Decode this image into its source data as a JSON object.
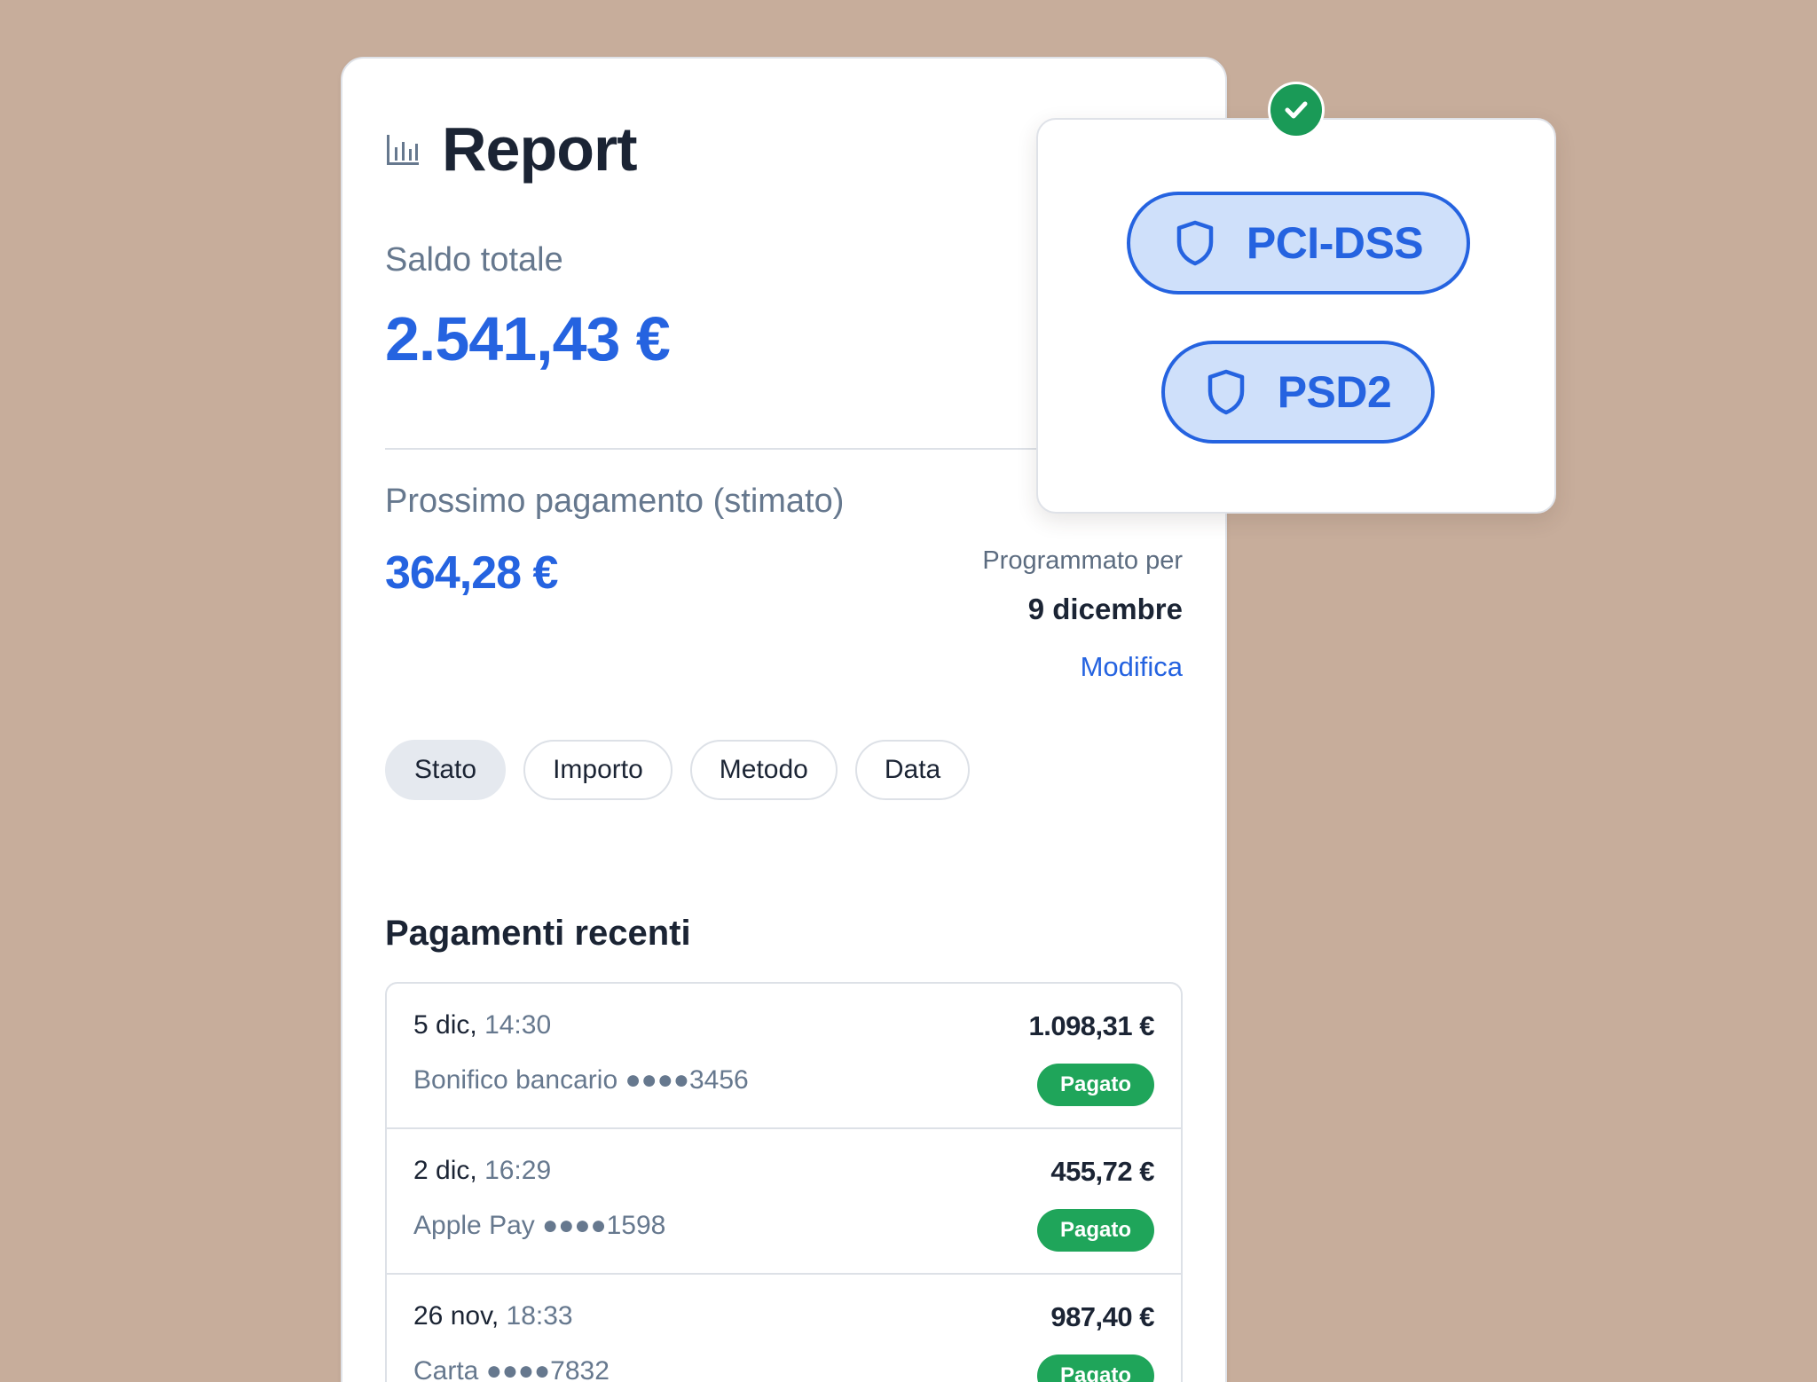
{
  "report": {
    "title": "Report",
    "balance": {
      "label": "Saldo totale",
      "value": "2.541,43 €"
    },
    "next_payment": {
      "label": "Prossimo pagamento (stimato)",
      "value": "364,28 €",
      "scheduled_label": "Programmato per",
      "scheduled_date": "9 dicembre",
      "edit_link": "Modifica"
    },
    "filters": [
      {
        "label": "Stato",
        "active": true
      },
      {
        "label": "Importo",
        "active": false
      },
      {
        "label": "Metodo",
        "active": false
      },
      {
        "label": "Data",
        "active": false
      }
    ],
    "recent": {
      "title": "Pagamenti recenti",
      "payments": [
        {
          "date": "5 dic,",
          "time": "14:30",
          "method": "Bonifico bancario ●●●●3456",
          "amount": "1.098,31 €",
          "status": "Pagato"
        },
        {
          "date": "2 dic,",
          "time": "16:29",
          "method": "Apple Pay ●●●●1598",
          "amount": "455,72 €",
          "status": "Pagato"
        },
        {
          "date": "26 nov,",
          "time": "18:33",
          "method": "Carta ●●●●7832",
          "amount": "987,40 €",
          "status": "Pagato"
        }
      ]
    }
  },
  "compliance": {
    "badges": [
      {
        "label": "PCI-DSS",
        "icon": "shield-icon"
      },
      {
        "label": "PSD2",
        "icon": "shield-icon"
      }
    ],
    "verified_icon": "check-icon"
  },
  "colors": {
    "background": "#c7ad9b",
    "accent_blue": "#2563e0",
    "pill_fill": "#cfe0fa",
    "status_green": "#1fa55a",
    "check_green": "#1a9a57"
  }
}
